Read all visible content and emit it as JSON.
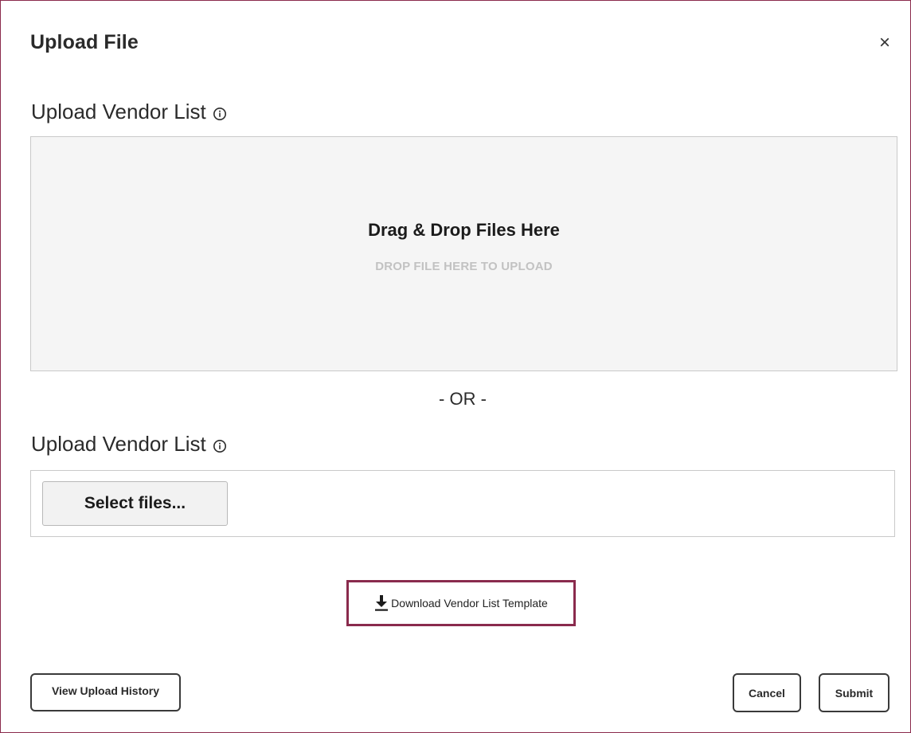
{
  "dialog": {
    "title": "Upload File",
    "close_symbol": "×",
    "close_icon": "close-icon"
  },
  "drop_section": {
    "label": "Upload Vendor List",
    "info_icon": "info-icon",
    "drop_title": "Drag & Drop Files Here",
    "drop_subtitle": "DROP FILE HERE TO UPLOAD"
  },
  "divider": {
    "text": "- OR -"
  },
  "select_section": {
    "label": "Upload Vendor List",
    "info_icon": "info-icon",
    "select_button_label": "Select files..."
  },
  "download": {
    "label": "Download Vendor List Template",
    "icon": "download-icon"
  },
  "footer": {
    "history_label": "View Upload History",
    "cancel_label": "Cancel",
    "submit_label": "Submit"
  },
  "colors": {
    "accent": "#8a2b4d",
    "drop_zone_bg": "#f5f5f5",
    "muted_text": "#c2c2c2"
  }
}
